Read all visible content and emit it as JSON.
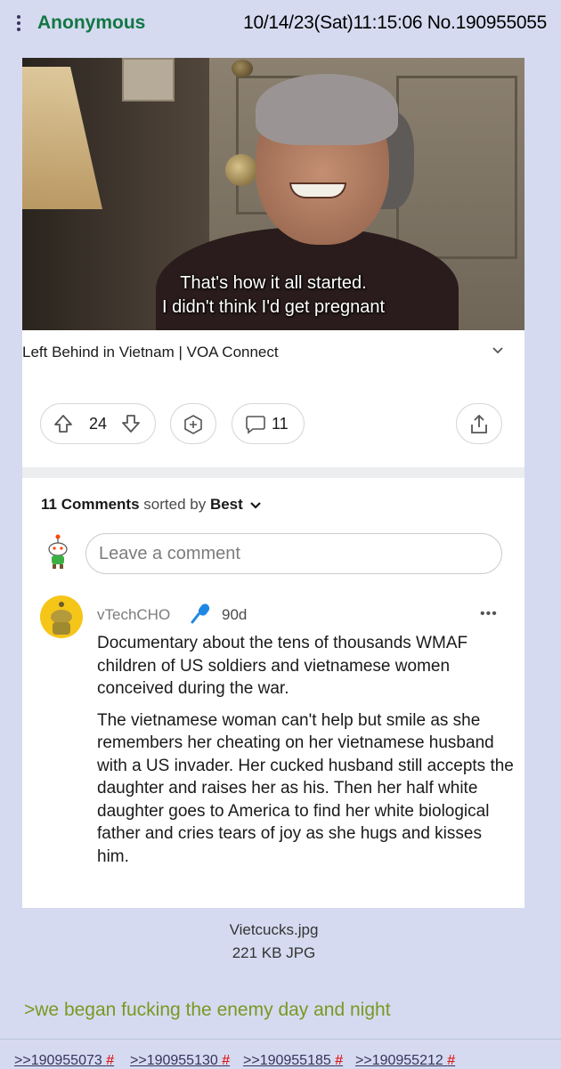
{
  "post": {
    "name": "Anonymous",
    "datetime": "10/14/23(Sat)11:15:06",
    "number": "No.190955055",
    "filename": "Vietcucks.jpg",
    "filesize": "221 KB JPG",
    "greentext": ">we began fucking the enemy day and night",
    "backlinks": [
      ">>190955073",
      ">>190955130",
      ">>190955185",
      ">>190955212"
    ],
    "backlink_hash": "#"
  },
  "screenshot": {
    "subtitle_line1": "That's how it all started.",
    "subtitle_line2": "I didn't think I'd get pregnant",
    "video_title": "Left Behind in Vietnam | VOA Connect",
    "vote_count": "24",
    "comment_count": "11",
    "comments_count_label": "11 Comments",
    "sorted_by_label": "sorted by",
    "sort_value": "Best",
    "leave_comment_placeholder": "Leave a comment",
    "comment": {
      "username": "vTechCHO",
      "age": "90d",
      "more": "•••",
      "paragraph1": "Documentary about the tens of thousands WMAF children of US soldiers and vietnamese women conceived during the war.",
      "paragraph2": "The vietnamese woman can't help but smile as she remembers her cheating on her vietnamese husband with a US invader. Her cucked husband still accepts the daughter and raises her as his. Then her half white daughter goes to America to find her white biological father and cries tears of joy as she hugs and kisses him."
    }
  },
  "icons": [
    "menu-dots-icon",
    "chevron-down-icon",
    "upvote-icon",
    "downvote-icon",
    "award-icon",
    "comment-icon",
    "share-icon",
    "snoo-icon",
    "mic-icon"
  ],
  "colors": {
    "background": "#d6daf0",
    "name": "#117743",
    "greentext": "#789922",
    "link": "#34345c",
    "hash": "#dd0000"
  }
}
